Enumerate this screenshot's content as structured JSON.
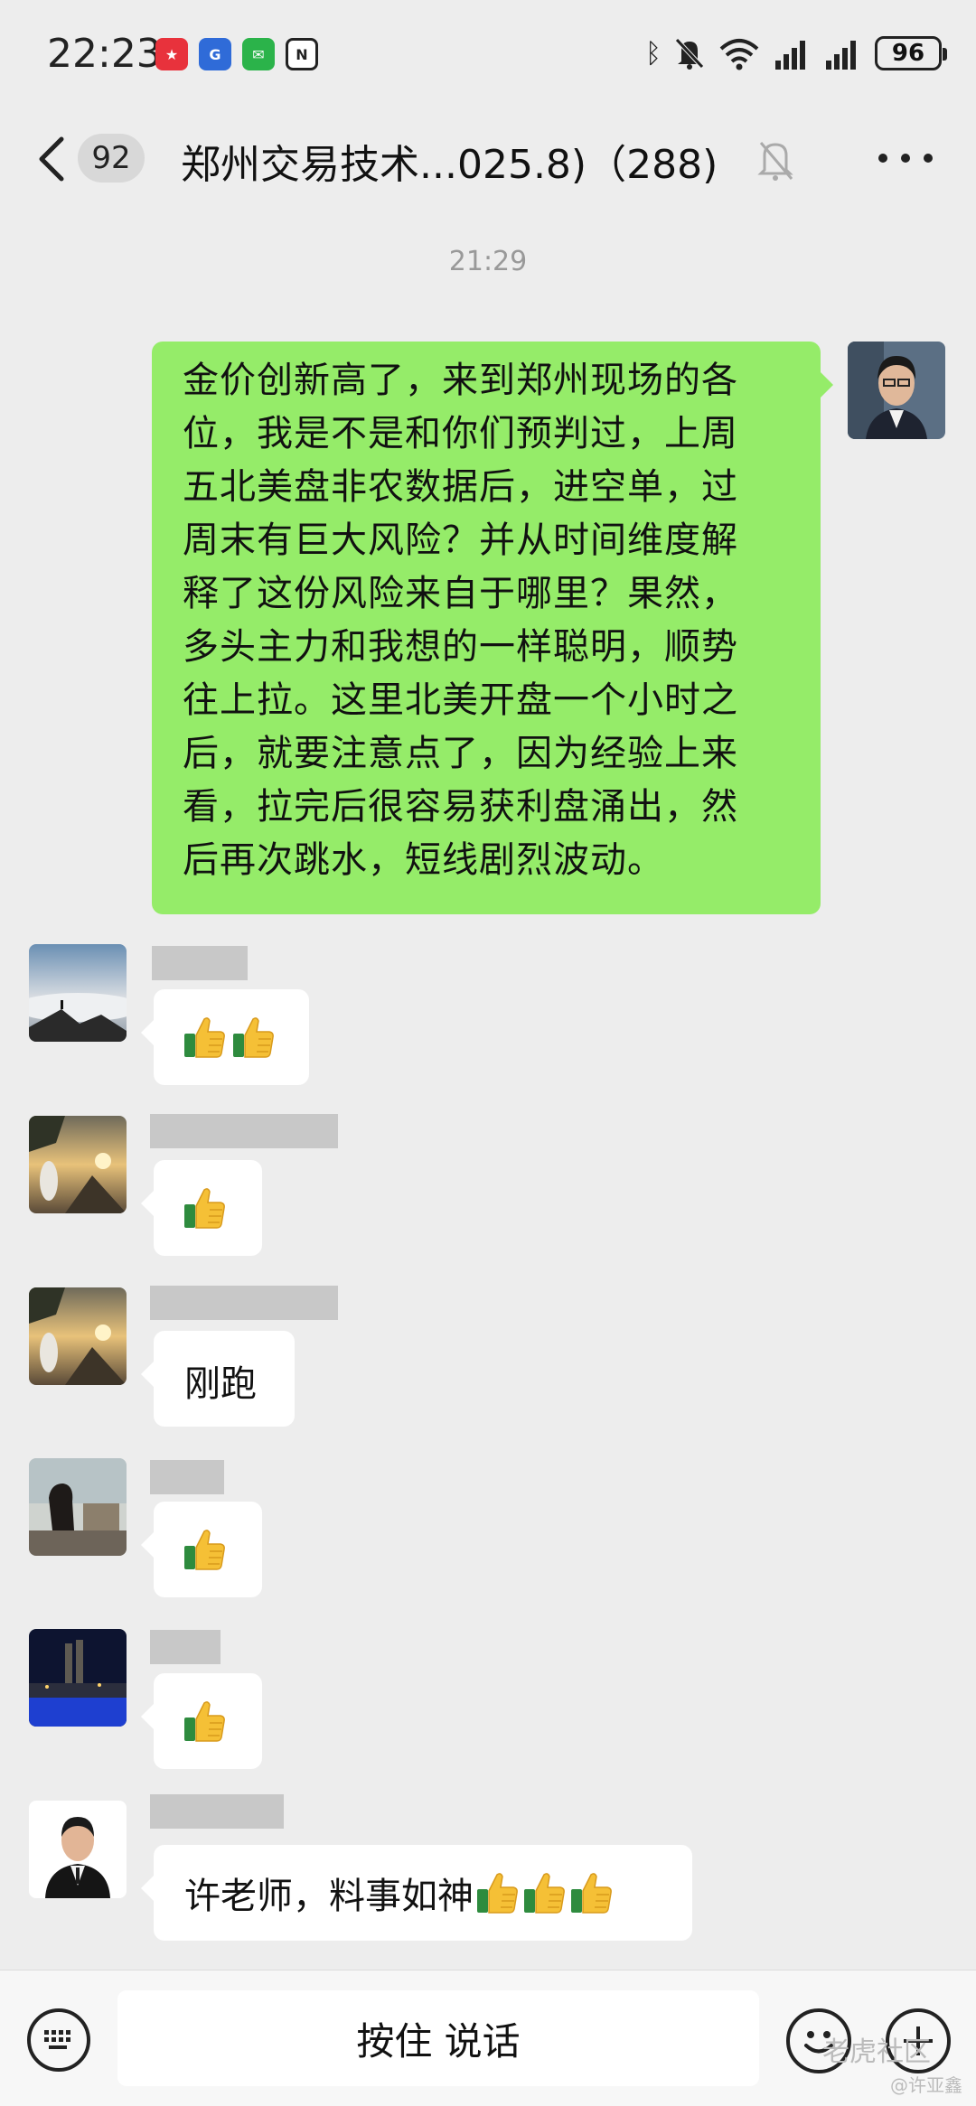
{
  "status_bar": {
    "time": "22:23",
    "battery": "96",
    "icons": [
      "bluetooth-icon",
      "mute-bell-icon",
      "wifi-icon",
      "signal-icon",
      "signal-icon"
    ]
  },
  "header": {
    "unread_count": "92",
    "title": "郑州交易技术...025.8)（288)"
  },
  "time_divider": "21:29",
  "messages": {
    "outgoing_text": [
      "金价创新高了，来到郑州现场的各",
      "位，我是不是和你们预判过，上周",
      "五北美盘非农数据后，进空单，过",
      "周末有巨大风险？并从时间维度解",
      "释了这份风险来自于哪里？果然，",
      "多头主力和我想的一样聪明，顺势",
      "往上拉。这里北美开盘一个小时之",
      "后，就要注意点了，因为经验上来",
      "看，拉完后很容易获利盘涌出，然",
      "后再次跳水，短线剧烈波动。"
    ],
    "reply_run": "刚跑",
    "reply_teacher": "许老师，料事如神"
  },
  "input_bar": {
    "hold_to_talk": "按住 说话"
  },
  "watermark": {
    "main": "老虎社区",
    "sub": "@许亚鑫"
  },
  "colors": {
    "background": "#ededed",
    "outgoing_bubble": "#95ec69",
    "incoming_bubble": "#ffffff"
  }
}
